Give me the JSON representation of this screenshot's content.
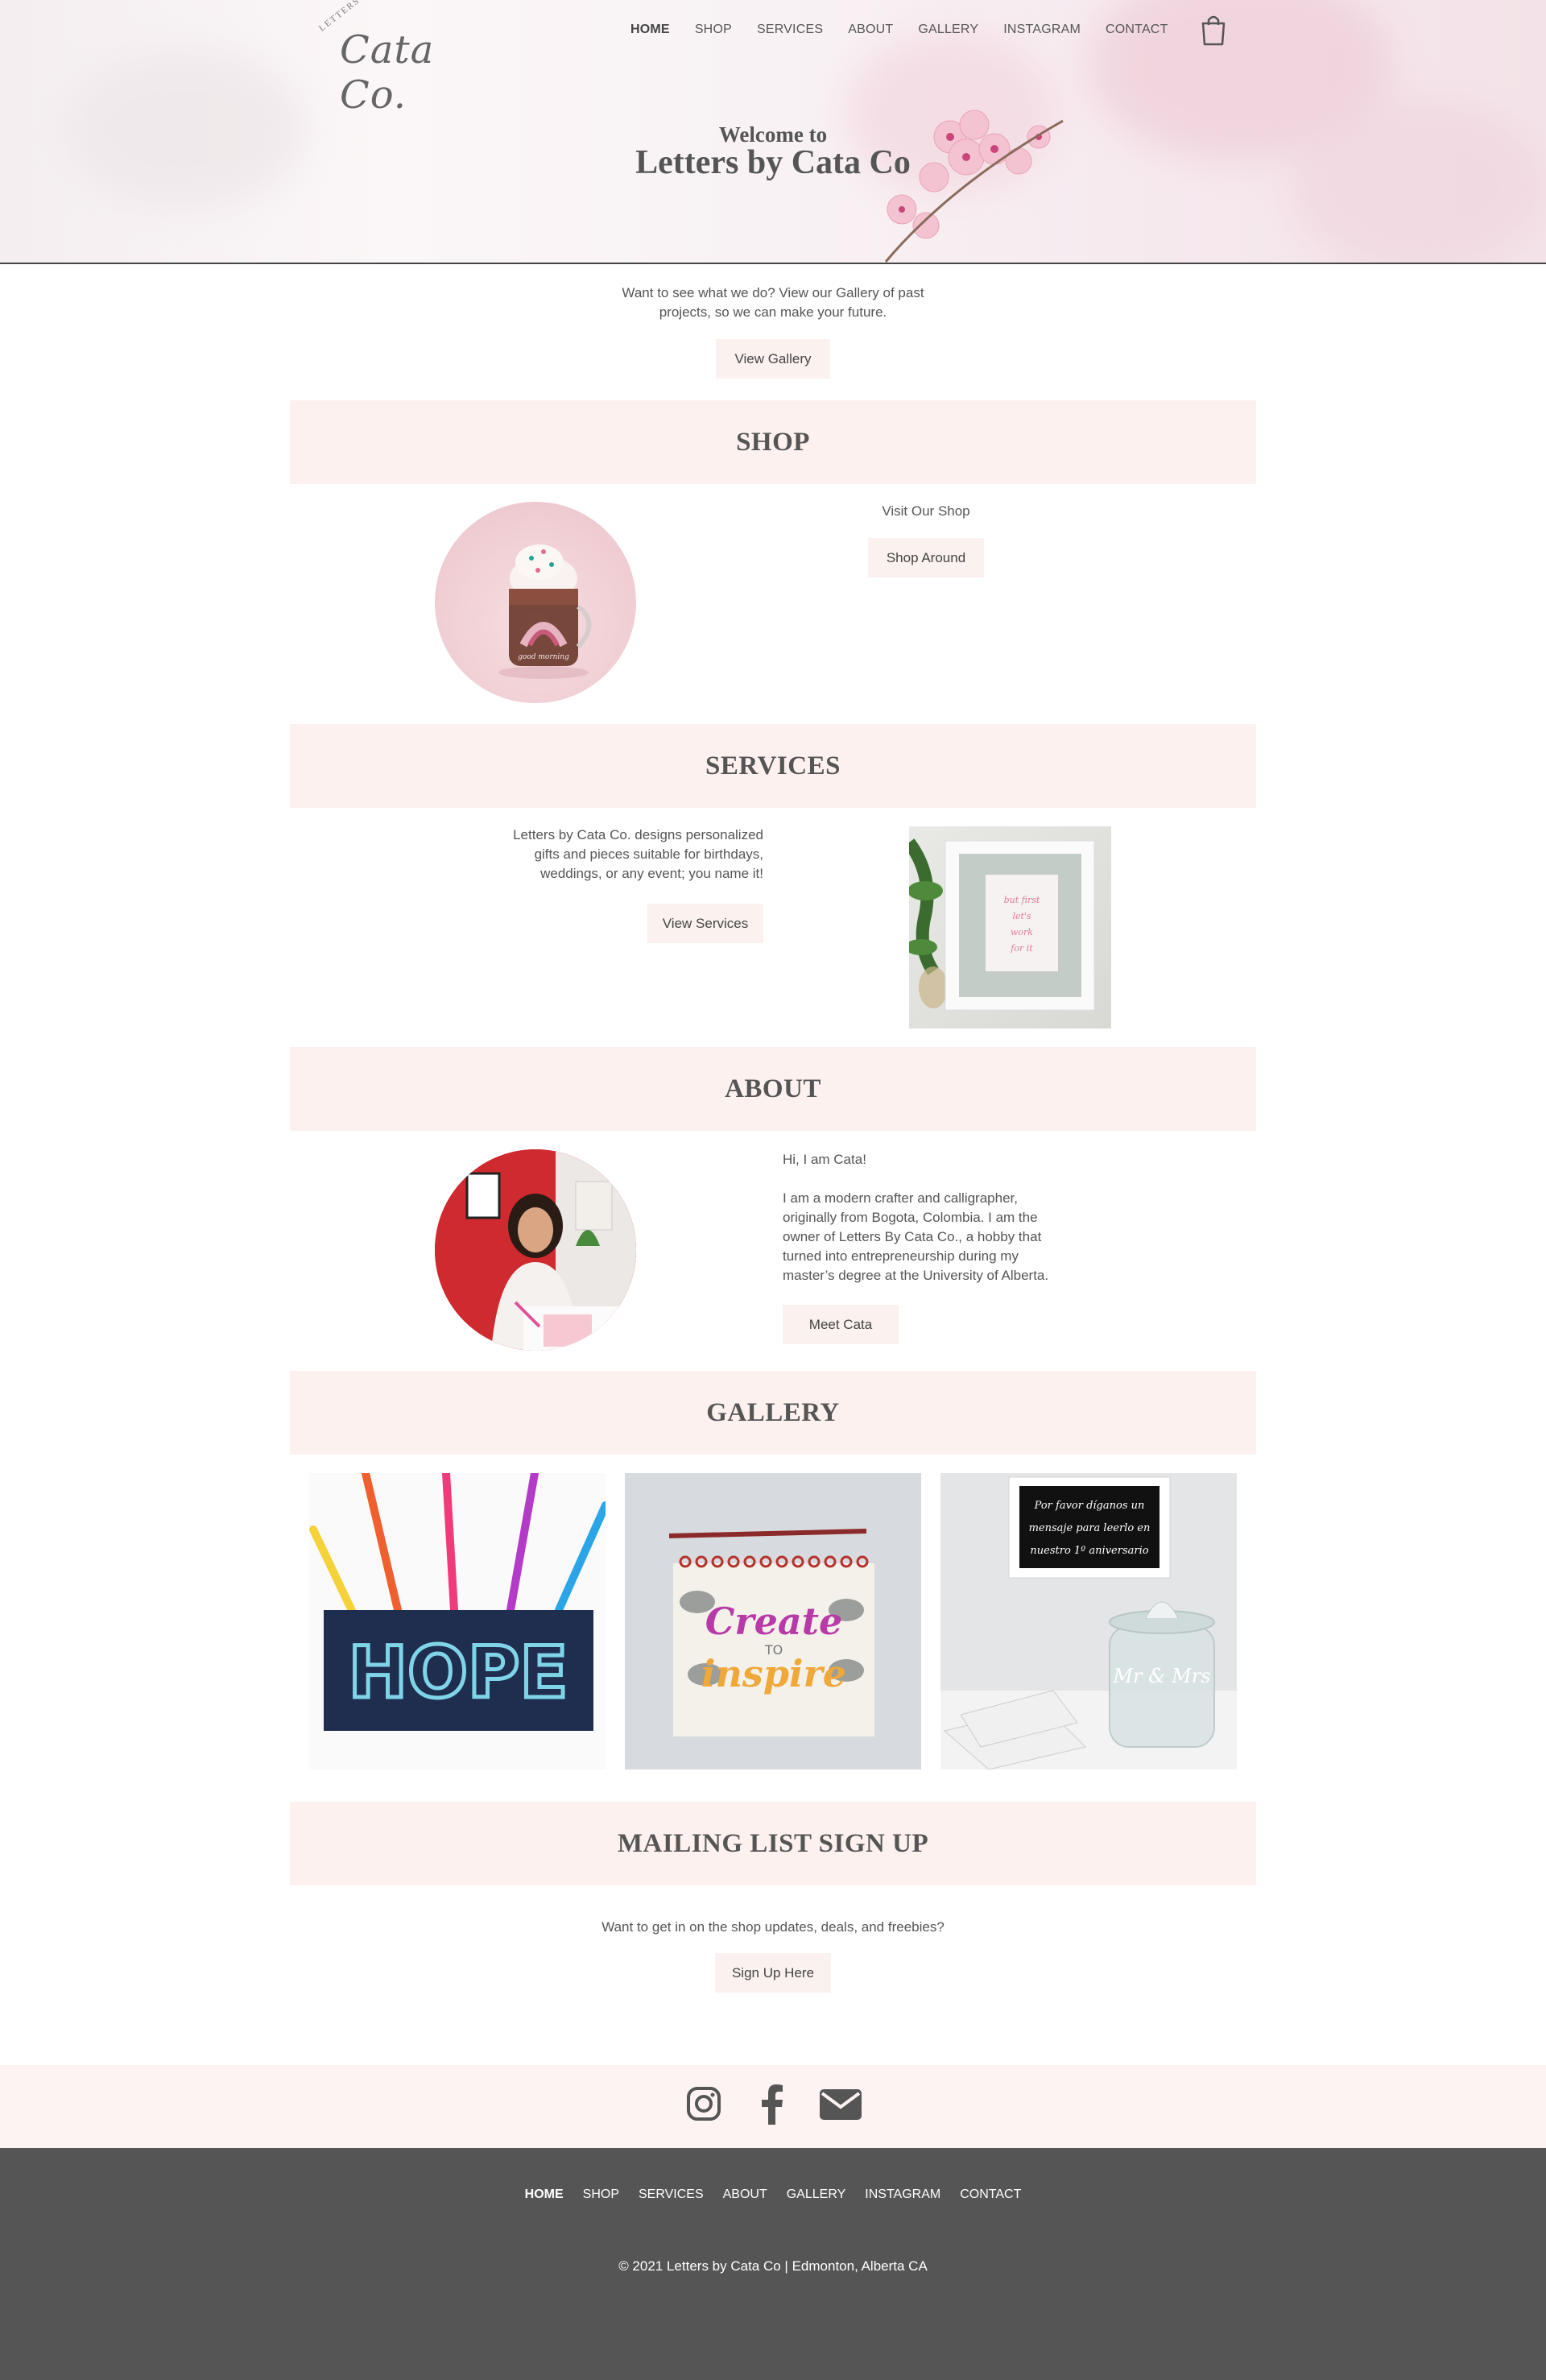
{
  "header": {
    "logo_small": "LETTERS BY",
    "logo_script": "Cata Co.",
    "nav": [
      "HOME",
      "SHOP",
      "SERVICES",
      "ABOUT",
      "GALLERY",
      "INSTAGRAM",
      "CONTACT"
    ],
    "active_nav": "HOME",
    "cart_icon": "shopping-bag-icon"
  },
  "hero": {
    "welcome": "Welcome to",
    "title": "Letters by Cata Co"
  },
  "intro": {
    "line1": "Want to see what we do? View our Gallery of past",
    "line2": "projects, so we can make your future.",
    "button": "View Gallery"
  },
  "shop": {
    "heading": "SHOP",
    "text": "Visit Our Shop",
    "button": "Shop Around"
  },
  "services": {
    "heading": "SERVICES",
    "line1": "Letters by Cata Co. designs personalized",
    "line2": "gifts and pieces suitable for birthdays,",
    "line3": "weddings, or any event; you name it!",
    "button": "View Services"
  },
  "about": {
    "heading": "ABOUT",
    "greeting": "Hi, I am Cata!",
    "lines": [
      "I am a modern crafter and calligrapher,",
      "originally from Bogota, Colombia. I am the",
      "owner of Letters By Cata Co., a hobby that",
      "turned into entrepreneurship during my",
      "master’s degree at the University of Alberta."
    ],
    "button": "Meet Cata"
  },
  "gallery": {
    "heading": "GALLERY",
    "img1_text": "HOPE",
    "img2_text1": "Create",
    "img2_text2": "TO",
    "img2_text3": "inspire",
    "img3_line1": "Por favor díganos un",
    "img3_line2": "mensaje para leerlo en",
    "img3_line3": "nuestro 1º aniversario",
    "img3_jar": "Mr & Mrs"
  },
  "mailing": {
    "heading": "MAILING LIST SIGN UP",
    "text": "Want to get in on the shop updates, deals, and freebies?",
    "button": "Sign Up Here"
  },
  "social": {
    "icons": [
      "instagram-icon",
      "facebook-icon",
      "email-icon"
    ]
  },
  "footer": {
    "nav": [
      "HOME",
      "SHOP",
      "SERVICES",
      "ABOUT",
      "GALLERY",
      "INSTAGRAM",
      "CONTACT"
    ],
    "copyright": "© 2021 Letters by Cata Co | Edmonton, Alberta CA"
  },
  "colors": {
    "band": "#fcf1ef",
    "button": "#fbf1ef",
    "footer": "#555555",
    "text": "#555555"
  }
}
